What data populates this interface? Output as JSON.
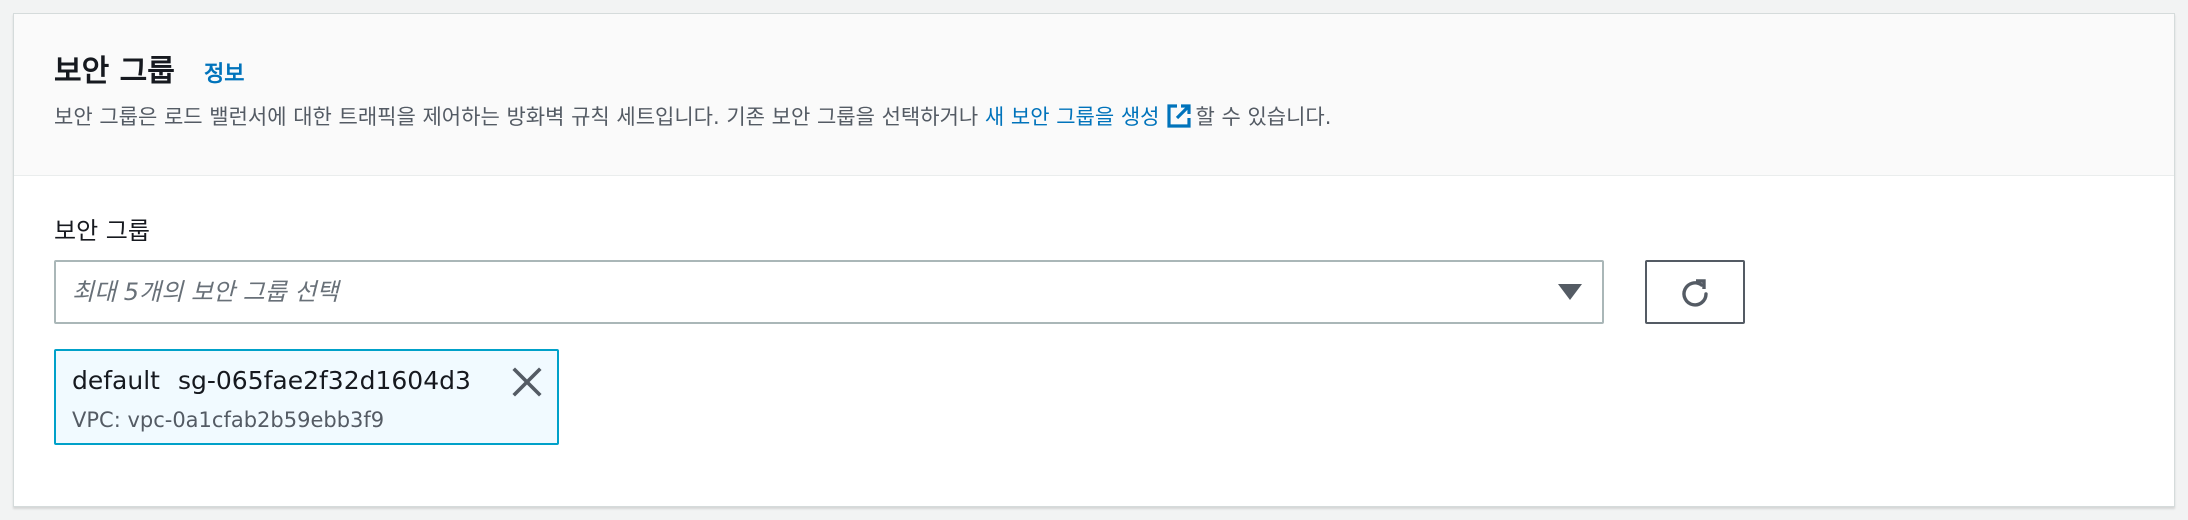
{
  "section": {
    "title": "보안 그룹",
    "info_link": "정보",
    "description_prefix": "보안 그룹은 로드 밸런서에 대한 트래픽을 제어하는 방화벽 규칙 세트입니다. 기존 보안 그룹을 선택하거나 ",
    "description_link": "새 보안 그룹을 생성",
    "description_suffix": "할 수 있습니다."
  },
  "field": {
    "label": "보안 그룹",
    "placeholder": "최대 5개의 보안 그룹 선택"
  },
  "selected_token": {
    "name": "default",
    "id": "sg-065fae2f32d1604d3",
    "vpc": "VPC: vpc-0a1cfab2b59ebb3f9"
  },
  "icons": {
    "external_link": "external-link-icon",
    "dropdown": "caret-down-icon",
    "refresh": "refresh-icon",
    "dismiss": "close-icon"
  },
  "colors": {
    "link": "#0073bb",
    "token_border": "#00a1c9",
    "token_bg": "#f1faff"
  }
}
